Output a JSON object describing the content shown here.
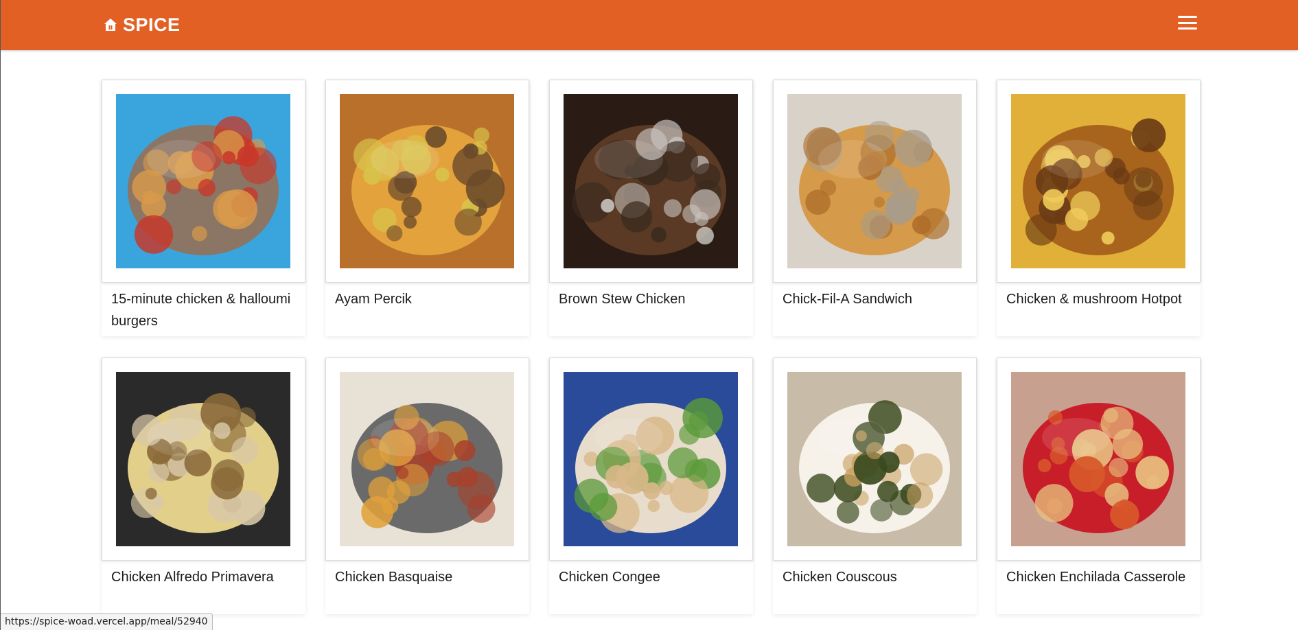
{
  "brand": {
    "name": "SPICE",
    "icon": "home-icon"
  },
  "nav": {
    "menu_icon": "hamburger-menu-icon"
  },
  "meals": [
    {
      "title": "15-minute chicken & halloumi burgers",
      "image": "burger-photo",
      "colors": [
        "#3aa4dc",
        "#8b7565",
        "#d89a4a",
        "#c8382a"
      ]
    },
    {
      "title": "Ayam Percik",
      "image": "grilled-chicken-photo",
      "colors": [
        "#b8702a",
        "#e3a23c",
        "#6a4a2a",
        "#d8c24a"
      ]
    },
    {
      "title": "Brown Stew Chicken",
      "image": "stew-photo",
      "colors": [
        "#2a1c14",
        "#5a3a24",
        "#c8c4c0",
        "#3a2a1e"
      ]
    },
    {
      "title": "Chick-Fil-A Sandwich",
      "image": "sandwich-photo",
      "colors": [
        "#d9d2c8",
        "#d59a4a",
        "#b0702c",
        "#a89c8a"
      ]
    },
    {
      "title": "Chicken & mushroom Hotpot",
      "image": "hotpot-photo",
      "colors": [
        "#e0b038",
        "#a8641c",
        "#f0cc5a",
        "#6a3a14"
      ]
    },
    {
      "title": "Chicken Alfredo Primavera",
      "image": "pasta-pan-photo",
      "colors": [
        "#2a2a2a",
        "#e2cf8a",
        "#8a6a3a",
        "#d8c8a8"
      ]
    },
    {
      "title": "Chicken Basquaise",
      "image": "casserole-photo",
      "colors": [
        "#e8e2d6",
        "#6a6a6a",
        "#a8402a",
        "#e0a03a"
      ]
    },
    {
      "title": "Chicken Congee",
      "image": "congee-photo",
      "colors": [
        "#2a4a9a",
        "#e8dccc",
        "#5a9a3a",
        "#d8b888"
      ]
    },
    {
      "title": "Chicken Couscous",
      "image": "couscous-photo",
      "colors": [
        "#c8bca8",
        "#f6f2ea",
        "#3a4a1e",
        "#c8a060"
      ]
    },
    {
      "title": "Chicken Enchilada Casserole",
      "image": "enchilada-photo",
      "colors": [
        "#c8a090",
        "#c81e2a",
        "#d8582a",
        "#e8c080"
      ]
    }
  ],
  "status_bar": {
    "url": "https://spice-woad.vercel.app/meal/52940"
  }
}
